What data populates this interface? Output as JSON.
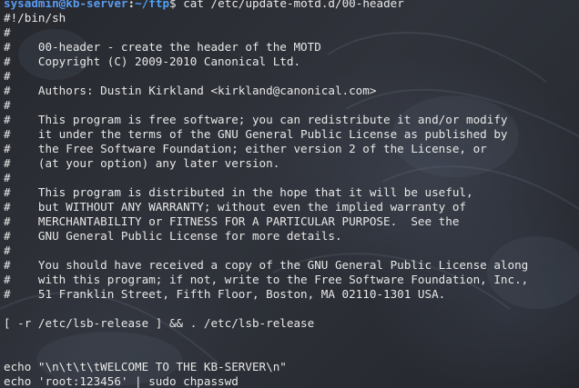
{
  "prompt": {
    "user": "sysadmin",
    "at": "@",
    "host": "kb-server",
    "colon": ":",
    "path": "~/ftp",
    "symbol": "$"
  },
  "command": " cat /etc/update-motd.d/00-header",
  "output_lines": [
    "#!/bin/sh",
    "#",
    "#    00-header - create the header of the MOTD",
    "#    Copyright (C) 2009-2010 Canonical Ltd.",
    "#",
    "#    Authors: Dustin Kirkland <kirkland@canonical.com>",
    "#",
    "#    This program is free software; you can redistribute it and/or modify",
    "#    it under the terms of the GNU General Public License as published by",
    "#    the Free Software Foundation; either version 2 of the License, or",
    "#    (at your option) any later version.",
    "#",
    "#    This program is distributed in the hope that it will be useful,",
    "#    but WITHOUT ANY WARRANTY; without even the implied warranty of",
    "#    MERCHANTABILITY or FITNESS FOR A PARTICULAR PURPOSE.  See the",
    "#    GNU General Public License for more details.",
    "#",
    "#    You should have received a copy of the GNU General Public License along",
    "#    with this program; if not, write to the Free Software Foundation, Inc.,",
    "#    51 Franklin Street, Fifth Floor, Boston, MA 02110-1301 USA.",
    "",
    "[ -r /etc/lsb-release ] && . /etc/lsb-release",
    "",
    "",
    "echo \"\\n\\t\\t\\tWELCOME TO THE KB-SERVER\\n\"",
    "echo 'root:123456' | sudo chpasswd"
  ],
  "colors": {
    "prompt_user_host": "#5a9bf0",
    "prompt_path": "#4fa0f5",
    "text": "#e8e8e8",
    "background": "#2c2f36"
  }
}
